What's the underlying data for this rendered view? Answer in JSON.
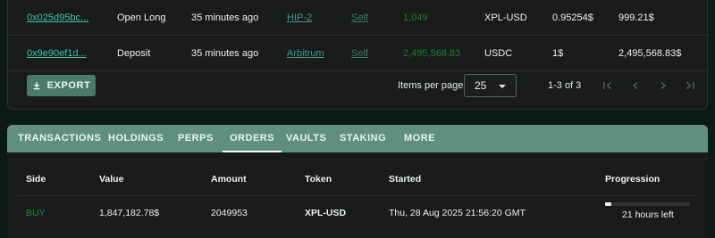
{
  "transactions": {
    "rows": [
      {
        "hash": "0x025d95bc...",
        "type": "Open Long",
        "time": "35 minutes ago",
        "chain": "HIP-2",
        "from": "Self",
        "amount": "1,049",
        "token": "XPL-USD",
        "price": "0.95254$",
        "total": "999.21$"
      },
      {
        "hash": "0x9e90ef1d...",
        "type": "Deposit",
        "time": "35 minutes ago",
        "chain": "Arbitrum",
        "from": "Self",
        "amount": "2,495,568.83",
        "token": "USDC",
        "price": "1$",
        "total": "2,495,568.83$"
      }
    ],
    "export_label": "EXPORT",
    "items_per_page_label": "Items per page:",
    "items_per_page_value": "25",
    "range_label": "1-3 of 3",
    "pager_icons": [
      "first-page-icon",
      "prev-page-icon",
      "next-page-icon",
      "last-page-icon"
    ]
  },
  "tabs": [
    "TRANSACTIONS",
    "HOLDINGS",
    "PERPS",
    "ORDERS",
    "VAULTS",
    "STAKING",
    "MORE"
  ],
  "active_tab": "ORDERS",
  "orders": {
    "headers": {
      "side": "Side",
      "value": "Value",
      "amount": "Amount",
      "token": "Token",
      "started": "Started",
      "progression": "Progression"
    },
    "rows": [
      {
        "side": "BUY",
        "value": "1,847,182.78$",
        "amount": "2049953",
        "token": "XPL-USD",
        "started": "Thu, 28 Aug 2025 21:56:20 GMT",
        "progress_fraction": 0.07,
        "progress_text": "21 hours left"
      }
    ]
  },
  "colors": {
    "accent": "#5f8f7e",
    "link": "#3ec6a5",
    "positive": "#1e8c2d",
    "panel": "#191a1a",
    "background": "#0c1a15"
  }
}
